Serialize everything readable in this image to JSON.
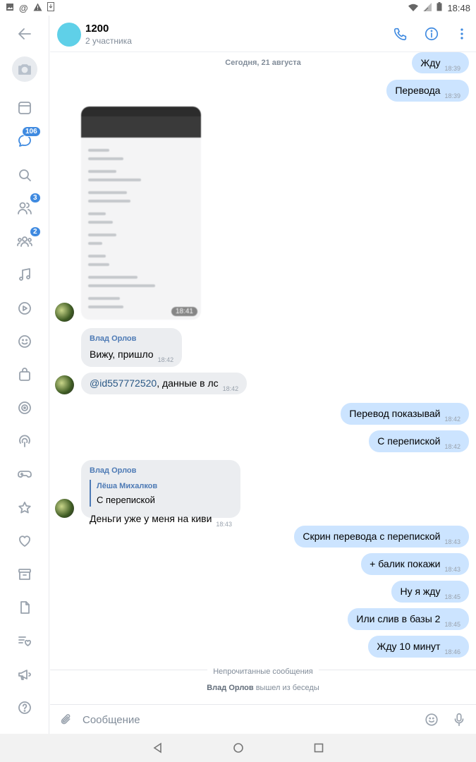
{
  "statusbar": {
    "time": "18:48"
  },
  "sidebar": {
    "badges": {
      "messages": "106",
      "friends": "3",
      "communities": "2"
    }
  },
  "header": {
    "title": "1200",
    "subtitle": "2 участника"
  },
  "date_label": "Сегодня, 21 августа",
  "messages": {
    "m1": {
      "text": "Жду",
      "time": "18:39"
    },
    "m2": {
      "text": "Перевода",
      "time": "18:39"
    },
    "photo": {
      "time": "18:41"
    },
    "m4": {
      "sender": "Влад Орлов",
      "text": "Вижу, пришло",
      "time": "18:42"
    },
    "m5": {
      "mention": "@id557772520",
      "text": ", данные в лс",
      "time": "18:42"
    },
    "m6": {
      "text": "Перевод показывай",
      "time": "18:42"
    },
    "m7": {
      "text": "С перепиской",
      "time": "18:42"
    },
    "m8": {
      "sender": "Влад Орлов",
      "reply_name": "Лёша Михалков",
      "reply_text": "С перепиской",
      "text": "Деньги уже у меня на киви",
      "time": "18:43"
    },
    "m9": {
      "text": "Скрин перевода с перепиской",
      "time": "18:43"
    },
    "m10": {
      "text": "+ балик покажи",
      "time": "18:43"
    },
    "m11": {
      "text": "Ну я жду",
      "time": "18:45"
    },
    "m12": {
      "text": "Или слив в базы 2",
      "time": "18:45"
    },
    "m13": {
      "text": "Жду 10 минут",
      "time": "18:46"
    }
  },
  "unread_label": "Непрочитанные сообщения",
  "service": {
    "name": "Влад Орлов",
    "text": " вышел из беседы"
  },
  "composer": {
    "placeholder": "Сообщение"
  },
  "colors": {
    "accent": "#3f8ae0",
    "outgoing": "#cce4ff",
    "incoming": "#ebedf0"
  }
}
